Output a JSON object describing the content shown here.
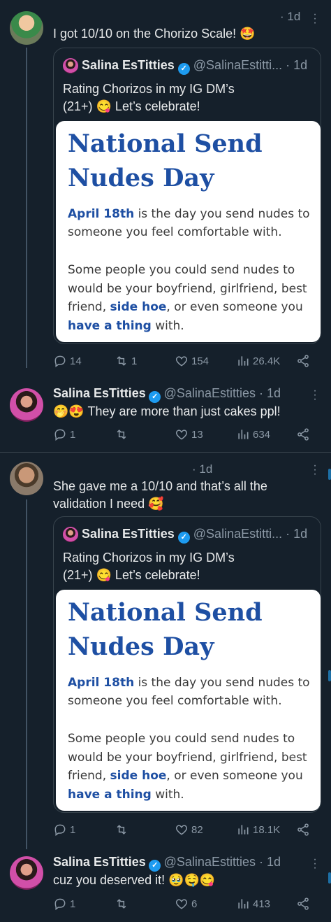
{
  "quoted_post": {
    "name": "Salina EsTitties",
    "handle": "@SalinaEstitti...",
    "time": "· 1d",
    "text_line1": "Rating Chorizos in my IG DM’s",
    "text_line2": "(21+) 😋 Let’s celebrate!",
    "card": {
      "title_line1": "National Send",
      "title_line2": "Nudes Day",
      "p1_bold": "April 18th",
      "p1_rest": " is the day you send nudes to someone you feel comfortable with.",
      "p2_a": "Some people you could send nudes to would be your boyfriend, girlfriend, best friend, ",
      "p2_bold1": "side hoe",
      "p2_b": ", or even someone you ",
      "p2_bold2": "have a thing",
      "p2_c": " with."
    }
  },
  "posts": [
    {
      "time": "· 1d",
      "text": "I got 10/10 on the Chorizo Scale! 🤩",
      "replies": "14",
      "reposts": "1",
      "likes": "154",
      "views": "26.4K"
    },
    {
      "name": "Salina EsTitties",
      "handle": "@SalinaEstitties · 1d",
      "text": "🤭😍 They are more than just cakes ppl!",
      "replies": "1",
      "reposts": "",
      "likes": "13",
      "views": "634"
    },
    {
      "time": "· 1d",
      "text_line1": "She gave me a 10/10 and that’s all the",
      "text_line2": "validation I need 🥰",
      "replies": "1",
      "reposts": "",
      "likes": "82",
      "views": "18.1K"
    },
    {
      "name": "Salina EsTitties",
      "handle": "@SalinaEstitties · 1d",
      "text": "cuz you deserved it! 🥹🤤😋",
      "replies": "1",
      "reposts": "",
      "likes": "6",
      "views": "413"
    }
  ],
  "icons": [
    "reply-icon",
    "repost-icon",
    "like-icon",
    "views-icon",
    "share-icon",
    "more-icon",
    "verified-badge-icon"
  ],
  "colors": {
    "background": "#15202b",
    "accent": "#1d9bf0",
    "muted": "#8b98a5",
    "card_title": "#1e4fa3"
  }
}
